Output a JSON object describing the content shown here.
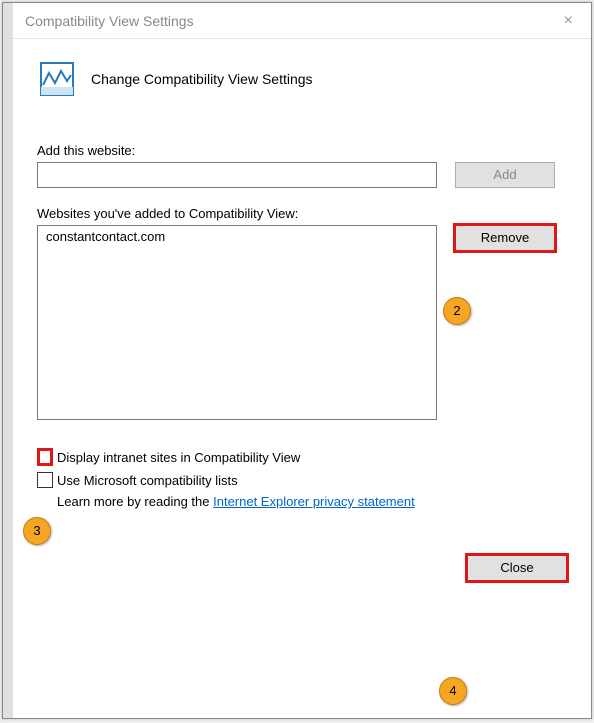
{
  "window": {
    "title": "Compatibility View Settings",
    "close_glyph": "×"
  },
  "header": {
    "title": "Change Compatibility View Settings"
  },
  "add_section": {
    "label": "Add this website:",
    "value": "",
    "add_button": "Add"
  },
  "list_section": {
    "label": "Websites you've added to Compatibility View:",
    "items": [
      "constantcontact.com"
    ],
    "remove_button": "Remove"
  },
  "checkboxes": {
    "intranet": "Display intranet sites in Compatibility View",
    "ms_lists": "Use Microsoft compatibility lists"
  },
  "learn": {
    "prefix": "Learn more by reading the ",
    "link_text": "Internet Explorer privacy statement"
  },
  "footer": {
    "close_button": "Close"
  },
  "callouts": {
    "c2": "2",
    "c3": "3",
    "c4": "4"
  }
}
